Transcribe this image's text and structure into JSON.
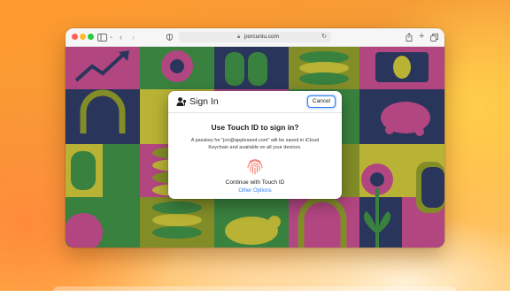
{
  "browser": {
    "url": "porcuniu.com",
    "icons": {
      "sidebar": "sidebar-icon",
      "back": "chevron-left-icon",
      "forward": "chevron-right-icon",
      "privacy": "privacy-shield-icon",
      "lock": "lock-icon",
      "reload": "reload-icon",
      "share": "share-icon",
      "new_tab": "plus-icon",
      "tabs": "tab-overview-icon"
    }
  },
  "dialog": {
    "title": "Sign In",
    "cancel_label": "Cancel",
    "heading": "Use Touch ID to sign in?",
    "body": "A passkey for \"jon@appleseed.com\" will be saved in iCloud Keychain and available on all your devices.",
    "continue_text": "Continue with Touch ID",
    "other_options": "Other Options",
    "icons": {
      "person": "person-key-icon",
      "fingerprint": "touch-id-fingerprint-icon"
    }
  },
  "colors": {
    "accent": "#2f7cf6",
    "fingerprint": "#f0796a",
    "tile_magenta": "#c24d8d",
    "tile_olive": "#8e9a2c",
    "tile_navy": "#2d3a63",
    "tile_green": "#3e8c45",
    "tile_yellow": "#c8c23a"
  }
}
